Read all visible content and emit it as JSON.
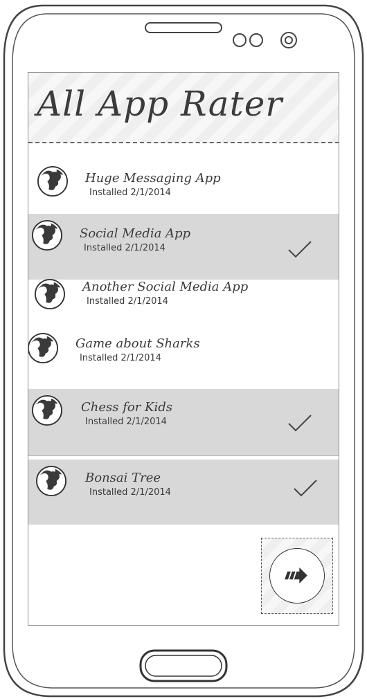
{
  "app": {
    "title": "All App Rater"
  },
  "apps": [
    {
      "name": "Huge Messaging App",
      "installed": "Installed 2/1/2014",
      "selected": false,
      "icon": "globe-icon"
    },
    {
      "name": "Social Media App",
      "installed": "Installed 2/1/2014",
      "selected": true,
      "icon": "globe-icon"
    },
    {
      "name": "Another Social Media App",
      "installed": "Installed 2/1/2014",
      "selected": false,
      "icon": "globe-icon"
    },
    {
      "name": "Game about Sharks",
      "installed": "Installed 2/1/2014",
      "selected": false,
      "icon": "globe-icon"
    },
    {
      "name": "Chess for Kids",
      "installed": "Installed 2/1/2014",
      "selected": true,
      "icon": "globe-icon"
    },
    {
      "name": "Bonsai Tree",
      "installed": "Installed 2/1/2014",
      "selected": true,
      "icon": "globe-icon"
    }
  ],
  "fab": {
    "icon": "arrow-right-icon"
  },
  "colors": {
    "selected_row": "#d8d8d8",
    "outline": "#3b3b3b"
  }
}
